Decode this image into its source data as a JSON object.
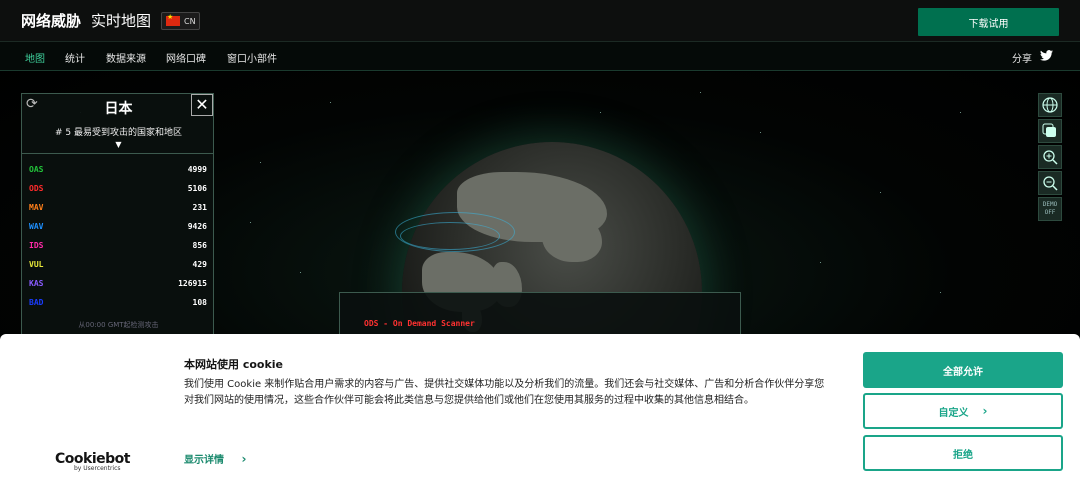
{
  "header": {
    "brand": "网络威胁",
    "subtitle": "实时地图",
    "lang_code": "CN",
    "trial_button": "下载试用"
  },
  "nav": {
    "items": [
      {
        "label": "地图",
        "active": true
      },
      {
        "label": "统计",
        "active": false
      },
      {
        "label": "数据来源",
        "active": false
      },
      {
        "label": "网络口碑",
        "active": false
      },
      {
        "label": "窗口小部件",
        "active": false
      }
    ],
    "share": "分享"
  },
  "stats": {
    "country": "日本",
    "rank": "# 5  最易受到攻击的国家和地区",
    "rows": [
      {
        "key": "OAS",
        "value": "4999",
        "color": "#22c53a"
      },
      {
        "key": "ODS",
        "value": "5106",
        "color": "#ff2b2b"
      },
      {
        "key": "MAV",
        "value": "231",
        "color": "#ff7f1a"
      },
      {
        "key": "WAV",
        "value": "9426",
        "color": "#1e90ff"
      },
      {
        "key": "IDS",
        "value": "856",
        "color": "#ff2aa8"
      },
      {
        "key": "VUL",
        "value": "429",
        "color": "#e8e83a"
      },
      {
        "key": "KAS",
        "value": "126915",
        "color": "#8a5cff"
      },
      {
        "key": "BAD",
        "value": "108",
        "color": "#1a3cff"
      }
    ],
    "since": "从00:00 GMT起检测攻击"
  },
  "tools": {
    "demo_line1": "DEMO",
    "demo_line2": "OFF"
  },
  "info": {
    "text": "ODS - On Demand Scanner"
  },
  "cookie": {
    "logo": "Cookiebot",
    "logo_sub": "by Usercentrics",
    "title": "本网站使用 cookie",
    "body": "我们使用 Cookie 来制作贴合用户需求的内容与广告、提供社交媒体功能以及分析我们的流量。我们还会与社交媒体、广告和分析合作伙伴分享您对我们网站的使用情况，这些合作伙伴可能会将此类信息与您提供给他们或他们在您使用其服务的过程中收集的其他信息相结合。",
    "details": "显示详情",
    "allow_all": "全部允许",
    "customize": "自定义",
    "reject": "拒绝"
  },
  "colors": {
    "accent": "#1aa589",
    "brand_green": "#00704f",
    "nav_active": "#3fd19c"
  }
}
